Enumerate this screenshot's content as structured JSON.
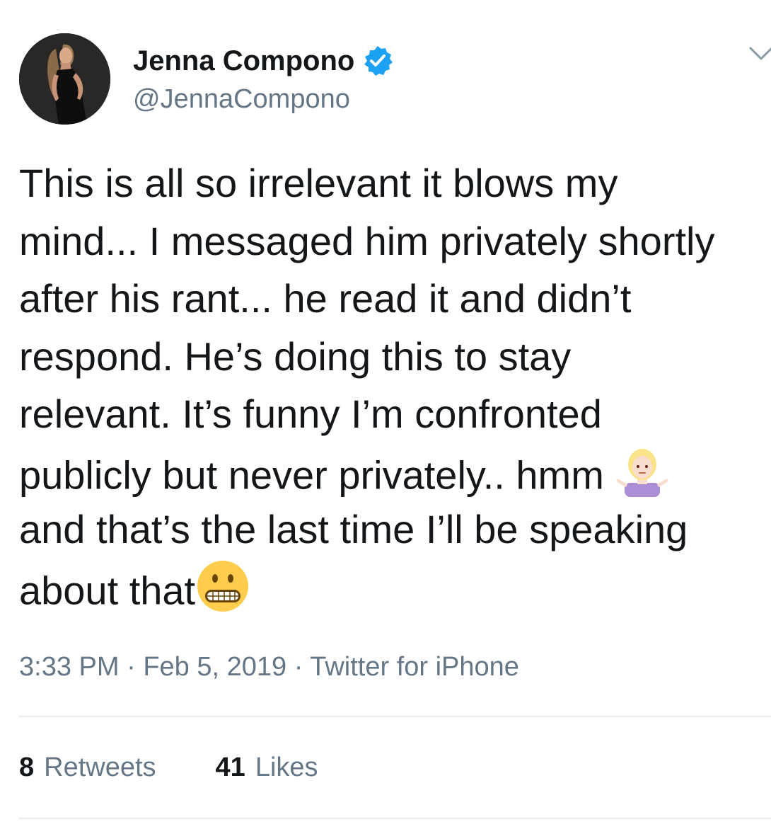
{
  "tweet": {
    "author": {
      "name": "Jenna Compono",
      "handle": "@JennaCompono",
      "verified": true,
      "verified_icon": "verified-badge-icon",
      "avatar_icon": "profile-photo"
    },
    "menu_icon": "chevron-down-icon",
    "text_lines": [
      "This is all so irrelevant it blows my",
      "mind... I messaged him privately shortly",
      "after his rant... he read it and didn’t",
      "respond. He’s doing this to stay",
      "relevant. It’s funny I’m confronted",
      "publicly but never privately.. hmm ",
      "and that’s the last time I’ll be speaking",
      "about that"
    ],
    "emojis": {
      "shrug": "person-shrugging-emoji",
      "grimace": "grimacing-face-emoji"
    },
    "timestamp": "3:33 PM",
    "date": "Feb 5, 2019",
    "source": "Twitter for iPhone",
    "separator": " · ",
    "retweets": {
      "count": "8",
      "label": "Retweets"
    },
    "likes": {
      "count": "41",
      "label": "Likes"
    }
  },
  "colors": {
    "text": "#14171a",
    "secondary": "#657786",
    "verified": "#1da1f2",
    "divider": "#e6ecf0"
  }
}
